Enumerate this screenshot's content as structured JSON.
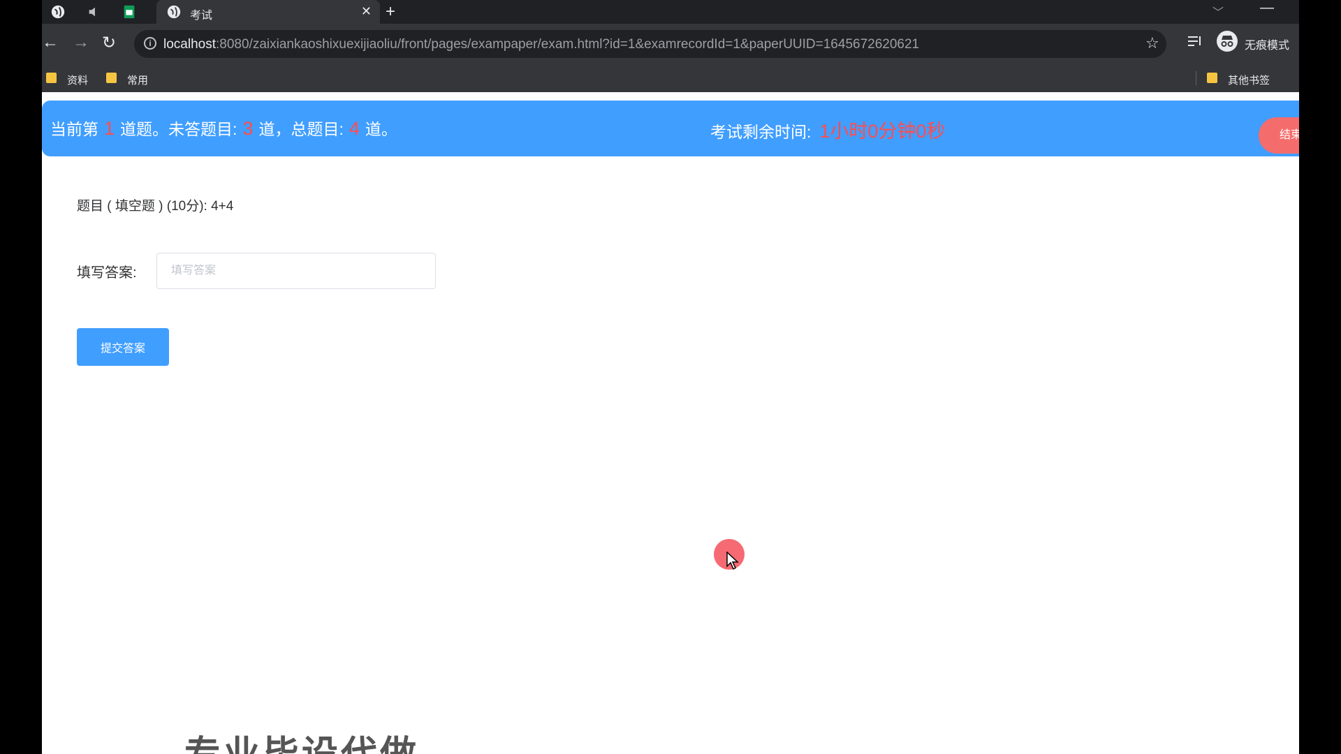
{
  "browser": {
    "tab_title": "考试",
    "url_host": "localhost",
    "url_path": ":8080/zaixiankaoshixuexijiaoliu/front/pages/exampaper/exam.html?id=1&examrecordId=1&paperUUID=1645672620621",
    "incognito_label": "无痕模式",
    "bookmarks": [
      "资料",
      "常用"
    ],
    "other_bookmarks": "其他书签"
  },
  "exam": {
    "status_prefix": "当前第",
    "current_index": "1",
    "status_mid1": "道题。未答题目:",
    "unanswered": "3",
    "status_mid2": "道，总题目:",
    "total": "4",
    "status_suffix": "道。",
    "timer_label": "考试剩余时间:",
    "timer_value": "1小时0分钟0秒",
    "end_button": "结束",
    "question_text": "题目 ( 填空题 ) (10分):   4+4",
    "answer_label": "填写答案:",
    "answer_placeholder": "填写答案",
    "submit_button": "提交答案",
    "watermark": "专业毕设代做"
  },
  "colors": {
    "banner": "#409eff",
    "highlight": "#ff4d4f",
    "end_button": "#f56c6c"
  }
}
